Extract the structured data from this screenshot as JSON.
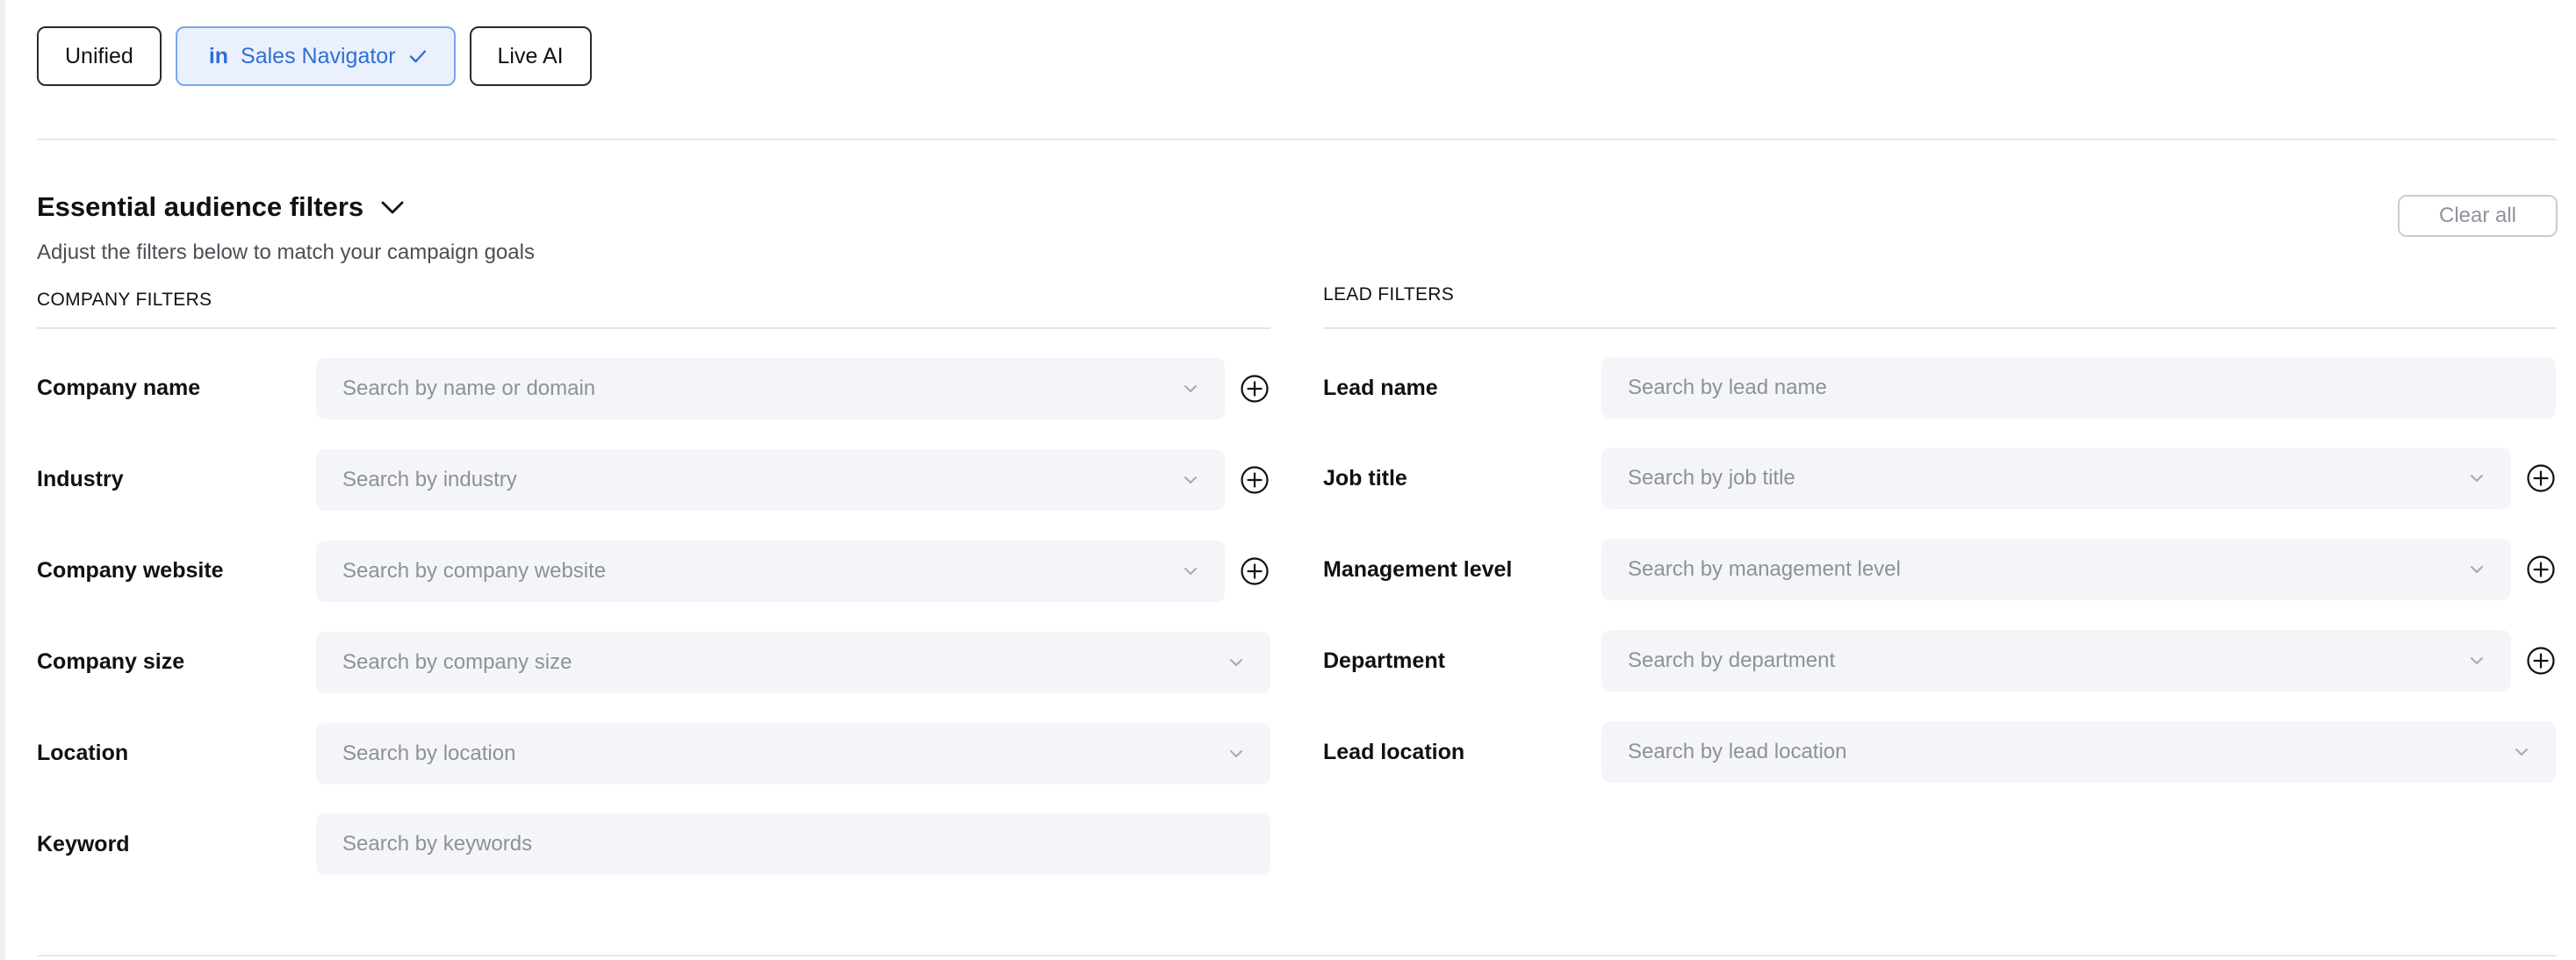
{
  "tabs": [
    {
      "label": "Unified",
      "active": false
    },
    {
      "label": "Sales Navigator",
      "active": true,
      "icon": "linkedin-in-icon",
      "icon_text": "in",
      "trailing_icon": "check-icon"
    },
    {
      "label": "Live AI",
      "active": false
    }
  ],
  "section": {
    "title": "Essential audience filters",
    "subtitle": "Adjust the filters below to match your campaign goals",
    "clear_label": "Clear all"
  },
  "company": {
    "heading": "COMPANY FILTERS",
    "rows": [
      {
        "label": "Company name",
        "placeholder": "Search by name or domain",
        "dropdown": true,
        "add": true
      },
      {
        "label": "Industry",
        "placeholder": "Search by industry",
        "dropdown": true,
        "add": true
      },
      {
        "label": "Company website",
        "placeholder": "Search by company website",
        "dropdown": true,
        "add": true
      },
      {
        "label": "Company size",
        "placeholder": "Search by company size",
        "dropdown": true,
        "add": false
      },
      {
        "label": "Location",
        "placeholder": "Search by location",
        "dropdown": true,
        "add": false
      },
      {
        "label": "Keyword",
        "placeholder": "Search by keywords",
        "dropdown": false,
        "add": false
      }
    ]
  },
  "lead": {
    "heading": "LEAD FILTERS",
    "rows": [
      {
        "label": "Lead name",
        "placeholder": "Search by lead name",
        "dropdown": false,
        "add": false
      },
      {
        "label": "Job title",
        "placeholder": "Search by job title",
        "dropdown": true,
        "add": true
      },
      {
        "label": "Management level",
        "placeholder": "Search by management level",
        "dropdown": true,
        "add": true
      },
      {
        "label": "Department",
        "placeholder": "Search by department",
        "dropdown": true,
        "add": true
      },
      {
        "label": "Lead location",
        "placeholder": "Search by lead location",
        "dropdown": true,
        "add": false
      }
    ]
  },
  "colors": {
    "accent": "#2f6fd6",
    "active_tab_bg": "#eaf1fd",
    "field_bg": "#f4f5f8",
    "placeholder": "#8d9199"
  }
}
